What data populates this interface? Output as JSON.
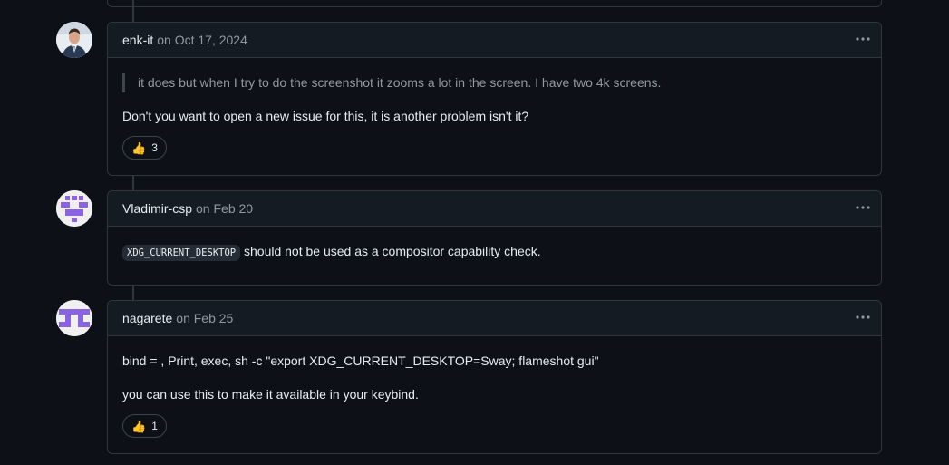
{
  "comments": [
    {
      "author": "enk-it",
      "date": "on Oct 17, 2024",
      "quote": "it does but when I try to do the screenshot it zooms a lot in the screen. I have two 4k screens.",
      "text": "Don't you want to open a new issue for this, it is another problem isn't it?",
      "reaction": {
        "emoji": "👍",
        "count": "3"
      }
    },
    {
      "author": "Vladimir-csp",
      "date": "on Feb 20",
      "code": "XDG_CURRENT_DESKTOP",
      "text": " should not be used as a compositor capability check."
    },
    {
      "author": "nagarete",
      "date": "on Feb 25",
      "line1": "bind = , Print, exec, sh -c \"export XDG_CURRENT_DESKTOP=Sway; flameshot gui\"",
      "line2": "you can use this to make it available in your keybind.",
      "reaction": {
        "emoji": "👍",
        "count": "1"
      }
    }
  ],
  "colors": {
    "background": "#0d1117",
    "border": "#30363d",
    "header_bg": "#151b23",
    "muted_text": "#9198a1",
    "avatar_purple": "#8a63e0"
  },
  "icons": [
    "kebab-horizontal-icon",
    "thumbs-up-icon"
  ]
}
